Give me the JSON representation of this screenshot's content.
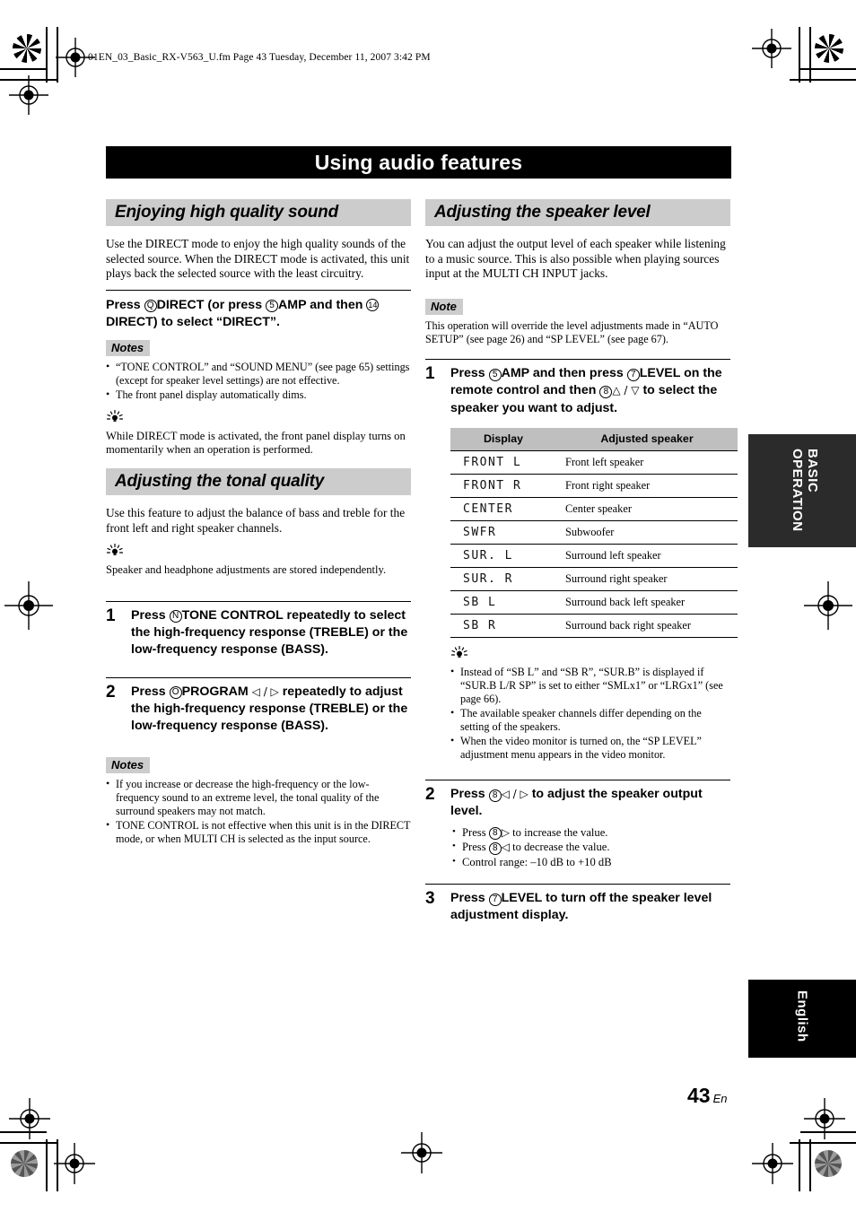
{
  "file_header": "01EN_03_Basic_RX-V563_U.fm  Page 43  Tuesday, December 11, 2007  3:42 PM",
  "chapter_title": "Using audio features",
  "page_number": "43",
  "page_number_suffix": "En",
  "side_tabs": {
    "basic": "BASIC OPERATION",
    "language": "English"
  },
  "left_column": {
    "section1": {
      "heading": "Enjoying high quality sound",
      "intro": "Use the DIRECT mode to enjoy the high quality sounds of the selected source. When the DIRECT mode is activated, this unit plays back the selected source with the least circuitry.",
      "instruction": {
        "press": "Press",
        "key1": "Q",
        "label1": "DIRECT",
        "mid": "(or press",
        "key2": "5",
        "label2": "AMP",
        "mid2": "and then",
        "key3": "14",
        "label3": "DIRECT",
        "tail": ") to select “DIRECT”."
      },
      "notes_label": "Notes",
      "notes": [
        "“TONE CONTROL” and “SOUND MENU” (see page 65) settings (except for speaker level settings) are not effective.",
        "The front panel display automatically dims."
      ],
      "tip": "While DIRECT mode is activated, the front panel display turns on momentarily when an operation is performed."
    },
    "section2": {
      "heading": "Adjusting the tonal quality",
      "intro": "Use this feature to adjust the balance of bass and treble for the front left and right speaker channels.",
      "tip": "Speaker and headphone adjustments are stored independently.",
      "steps": [
        {
          "num": "1",
          "press": "Press",
          "key": "N",
          "label": "TONE CONTROL",
          "tail": "repeatedly to select the high-frequency response (TREBLE) or the low-frequency response (BASS)."
        },
        {
          "num": "2",
          "press": "Press",
          "key": "O",
          "label": "PROGRAM",
          "arrows": "◁ / ▷",
          "tail": "repeatedly to adjust the high-frequency response (TREBLE) or the low-frequency response (BASS)."
        }
      ],
      "notes_label": "Notes",
      "notes": [
        "If you increase or decrease the high-frequency or the low-frequency sound to an extreme level, the tonal quality of the surround speakers may not match.",
        "TONE CONTROL is not effective when this unit is in the DIRECT mode, or when MULTI CH is selected as the input source."
      ]
    }
  },
  "right_column": {
    "section": {
      "heading": "Adjusting the speaker level",
      "intro": "You can adjust the output level of each speaker while listening to a music source. This is also possible when playing sources input at the MULTI CH INPUT jacks.",
      "note_label": "Note",
      "note": "This operation will override the level adjustments made in “AUTO SETUP” (see page 26) and “SP LEVEL” (see page 67).",
      "step1": {
        "num": "1",
        "press1": "Press",
        "key1": "5",
        "label1": "AMP",
        "mid": "and then press",
        "key2": "7",
        "label2": "LEVEL",
        "line2a": "on the remote control  and then",
        "key3": "8",
        "arrows": "△ / ▽",
        "tail": "to select the speaker you want to adjust."
      },
      "table": {
        "headers": [
          "Display",
          "Adjusted speaker"
        ],
        "rows": [
          {
            "display": "FRONT L",
            "speaker": "Front left speaker"
          },
          {
            "display": "FRONT R",
            "speaker": "Front right speaker"
          },
          {
            "display": "CENTER",
            "speaker": "Center speaker"
          },
          {
            "display": "SWFR",
            "speaker": "Subwoofer"
          },
          {
            "display": "SUR. L",
            "speaker": "Surround left speaker"
          },
          {
            "display": "SUR. R",
            "speaker": "Surround right speaker"
          },
          {
            "display": "SB L",
            "speaker": "Surround back left speaker"
          },
          {
            "display": "SB R",
            "speaker": "Surround back right speaker"
          }
        ]
      },
      "tips": [
        "Instead of “SB L” and “SB R”, “SUR.B” is displayed if “SUR.B L/R SP” is set to either “SMLx1” or “LRGx1” (see page 66).",
        "The available speaker channels differ depending on the setting of the speakers.",
        "When the video monitor is turned on, the “SP LEVEL” adjustment menu appears in the video monitor."
      ],
      "step2": {
        "num": "2",
        "press": "Press",
        "key": "8",
        "arrows": "◁ / ▷",
        "tail": "to adjust the speaker output level.",
        "sub": [
          {
            "press": "Press",
            "key": "8",
            "arrow": "▷",
            "text": "to increase the value."
          },
          {
            "press": "Press",
            "key": "8",
            "arrow": "◁",
            "text": "to decrease the value."
          },
          {
            "text_only": "Control range: –10 dB to +10 dB"
          }
        ]
      },
      "step3": {
        "num": "3",
        "press": "Press",
        "key": "7",
        "label": "LEVEL",
        "tail": "to turn off the speaker level adjustment display."
      }
    }
  },
  "colors": {
    "section_heading_bg": "#cccccc",
    "chapter_bar_bg": "#000000",
    "table_header_bg": "#bfbfbf",
    "tab_basic_bg": "#2b2b2b",
    "tab_english_bg": "#000000"
  }
}
